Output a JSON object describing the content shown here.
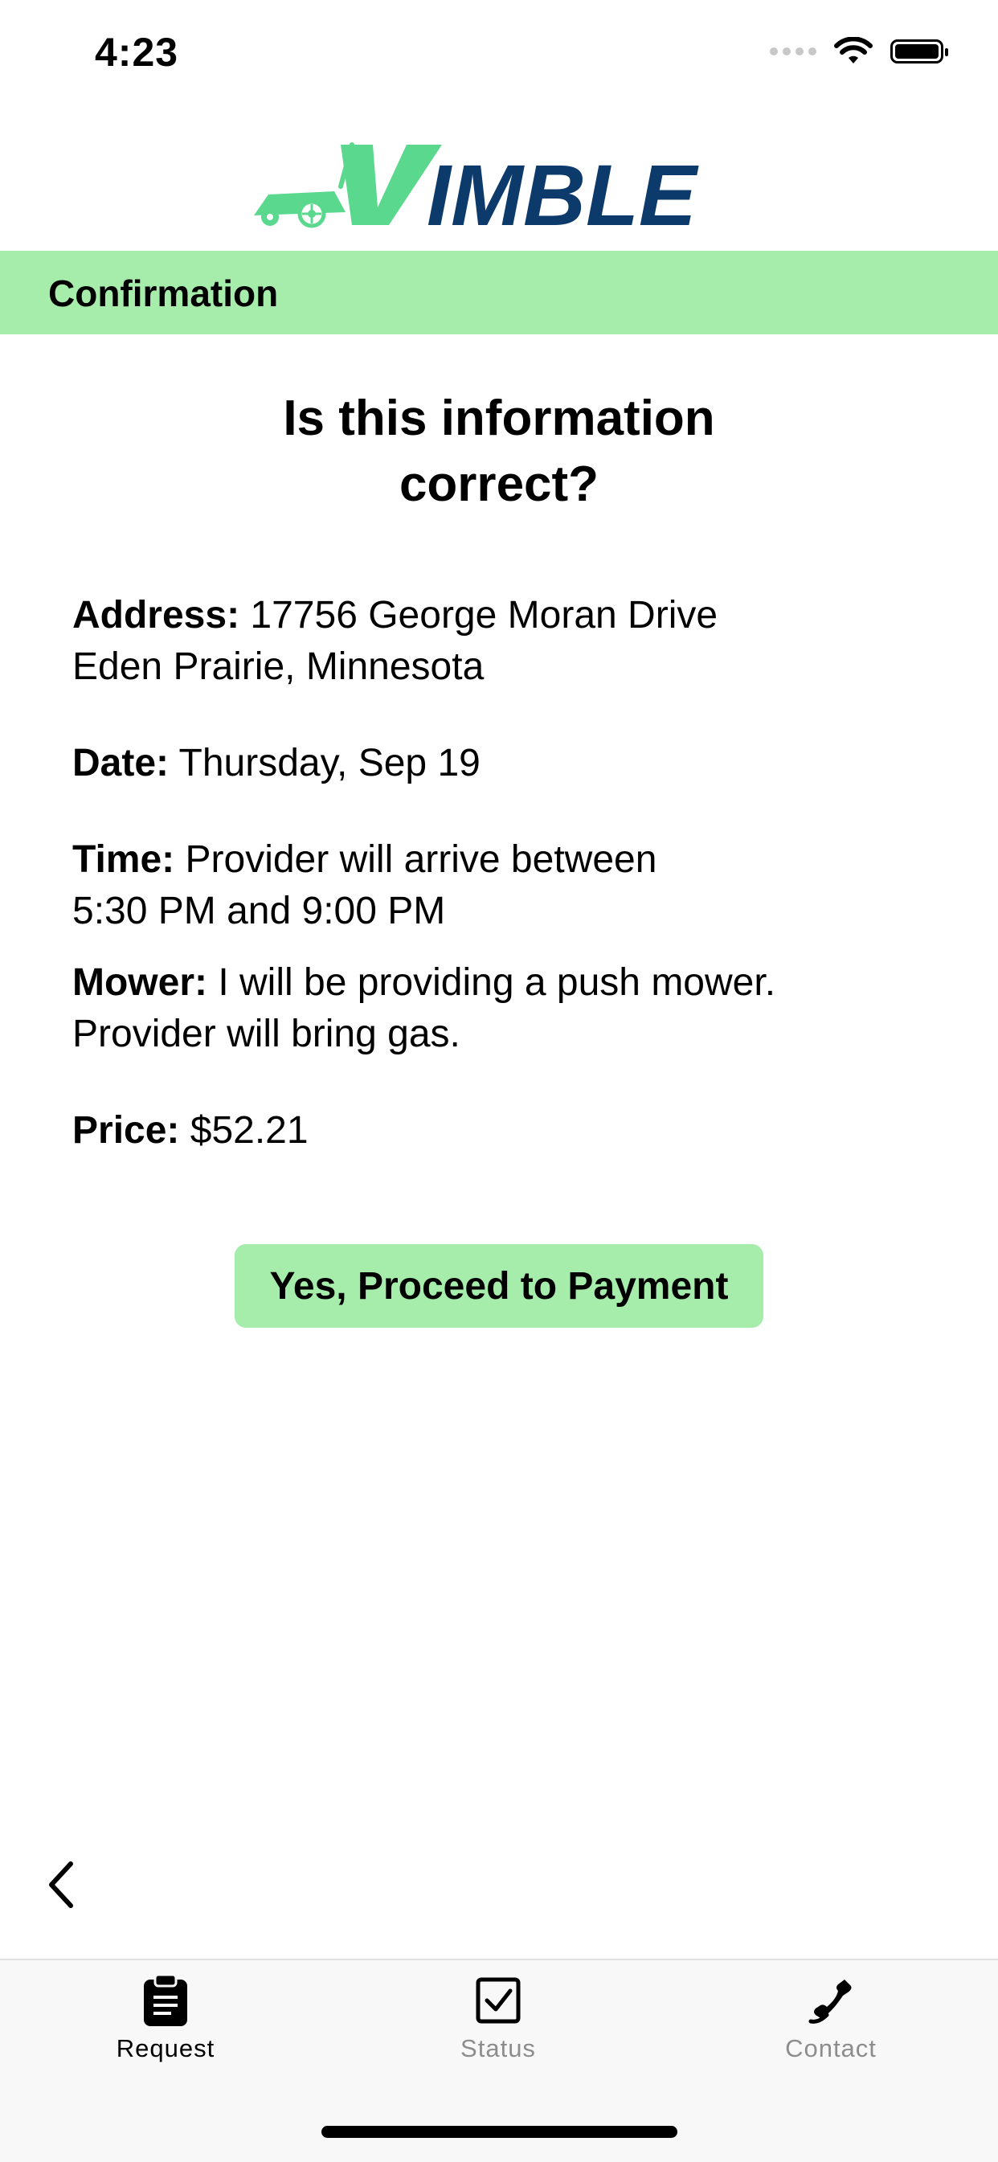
{
  "status_bar": {
    "time": "4:23"
  },
  "logo": {
    "text": "VIMBLE",
    "colors": {
      "accent": "#5ad88e",
      "navy": "#0b3a6b"
    }
  },
  "header": {
    "title": "Confirmation",
    "band_color": "#a6edab"
  },
  "question": {
    "line1": "Is this information",
    "line2": "correct?"
  },
  "details": {
    "address": {
      "label": "Address:",
      "line1": "17756 George Moran Drive",
      "line2": "Eden Prairie, Minnesota"
    },
    "date": {
      "label": "Date:",
      "value": "Thursday, Sep 19"
    },
    "time": {
      "label": "Time:",
      "line1": "Provider will arrive between",
      "line2": "5:30 PM and 9:00 PM"
    },
    "mower": {
      "label": "Mower:",
      "line1": "I will be providing a push mower.",
      "line2": "Provider will bring gas."
    },
    "price": {
      "label": "Price:",
      "value": "$52.21"
    }
  },
  "proceed_button": {
    "label": "Yes, Proceed to Payment"
  },
  "back": {
    "icon": "chevron-left-icon"
  },
  "tab_bar": {
    "tabs": [
      {
        "label": "Request",
        "icon": "clipboard-icon",
        "active": true
      },
      {
        "label": "Status",
        "icon": "checkbox-icon",
        "active": false
      },
      {
        "label": "Contact",
        "icon": "phone-icon",
        "active": false
      }
    ]
  }
}
